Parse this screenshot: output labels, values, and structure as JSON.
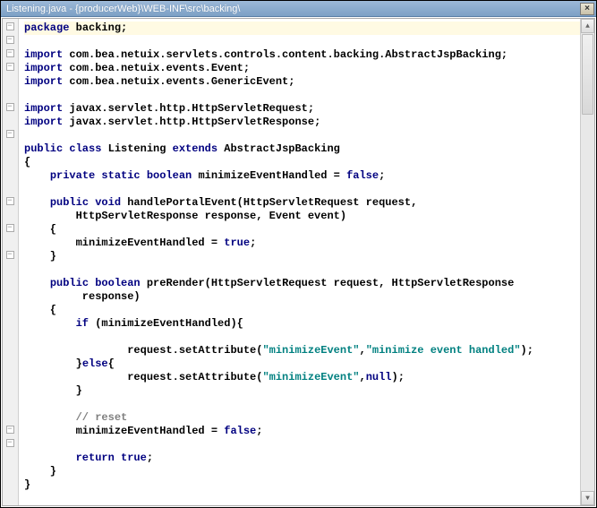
{
  "title": "Listening.java - {producerWeb}\\WEB-INF\\src\\backing\\",
  "close_label": "×",
  "gutter": {
    "fold_marks": [
      58,
      73,
      88,
      103,
      148,
      178,
      253,
      283,
      313,
      508,
      523
    ],
    "override_at": 283,
    "override_glyph": "○"
  },
  "code": {
    "lines": [
      {
        "type": "hl",
        "segments": [
          [
            "kw",
            "package"
          ],
          [
            "plain",
            " backing;"
          ]
        ]
      },
      {
        "segments": []
      },
      {
        "segments": [
          [
            "kw",
            "import"
          ],
          [
            "plain",
            " com.bea.netuix.servlets.controls.content.backing.AbstractJspBacking;"
          ]
        ]
      },
      {
        "segments": [
          [
            "kw",
            "import"
          ],
          [
            "plain",
            " com.bea.netuix.events.Event;"
          ]
        ]
      },
      {
        "segments": [
          [
            "kw",
            "import"
          ],
          [
            "plain",
            " com.bea.netuix.events.GenericEvent;"
          ]
        ]
      },
      {
        "segments": []
      },
      {
        "segments": [
          [
            "kw",
            "import"
          ],
          [
            "plain",
            " javax.servlet.http.HttpServletRequest;"
          ]
        ]
      },
      {
        "segments": [
          [
            "kw",
            "import"
          ],
          [
            "plain",
            " javax.servlet.http.HttpServletResponse;"
          ]
        ]
      },
      {
        "segments": []
      },
      {
        "segments": [
          [
            "kw",
            "public class"
          ],
          [
            "plain",
            " Listening "
          ],
          [
            "kw",
            "extends"
          ],
          [
            "plain",
            " AbstractJspBacking"
          ]
        ]
      },
      {
        "segments": [
          [
            "plain",
            "{"
          ]
        ]
      },
      {
        "segments": [
          [
            "plain",
            "    "
          ],
          [
            "kw",
            "private static boolean"
          ],
          [
            "plain",
            " minimizeEventHandled = "
          ],
          [
            "kw",
            "false"
          ],
          [
            "plain",
            ";"
          ]
        ]
      },
      {
        "segments": []
      },
      {
        "segments": [
          [
            "plain",
            "    "
          ],
          [
            "kw",
            "public void"
          ],
          [
            "plain",
            " handlePortalEvent(HttpServletRequest request,"
          ]
        ]
      },
      {
        "segments": [
          [
            "plain",
            "        HttpServletResponse response, Event event)"
          ]
        ]
      },
      {
        "segments": [
          [
            "plain",
            "    {"
          ]
        ]
      },
      {
        "segments": [
          [
            "plain",
            "        minimizeEventHandled = "
          ],
          [
            "kw",
            "true"
          ],
          [
            "plain",
            ";"
          ]
        ]
      },
      {
        "segments": [
          [
            "plain",
            "    }"
          ]
        ]
      },
      {
        "segments": []
      },
      {
        "segments": [
          [
            "plain",
            "    "
          ],
          [
            "kw",
            "public boolean"
          ],
          [
            "plain",
            " preRender(HttpServletRequest request, HttpServletResponse"
          ]
        ]
      },
      {
        "segments": [
          [
            "plain",
            "         response)"
          ]
        ]
      },
      {
        "segments": [
          [
            "plain",
            "    {"
          ]
        ]
      },
      {
        "segments": [
          [
            "plain",
            "        "
          ],
          [
            "kw",
            "if"
          ],
          [
            "plain",
            " (minimizeEventHandled){"
          ]
        ]
      },
      {
        "segments": []
      },
      {
        "segments": [
          [
            "plain",
            "                request.setAttribute("
          ],
          [
            "str",
            "\"minimizeEvent\""
          ],
          [
            "plain",
            ","
          ],
          [
            "str",
            "\"minimize event handled\""
          ],
          [
            "plain",
            ");"
          ]
        ]
      },
      {
        "segments": [
          [
            "plain",
            "        }"
          ],
          [
            "kw",
            "else"
          ],
          [
            "plain",
            "{"
          ]
        ]
      },
      {
        "segments": [
          [
            "plain",
            "                request.setAttribute("
          ],
          [
            "str",
            "\"minimizeEvent\""
          ],
          [
            "plain",
            ","
          ],
          [
            "kw",
            "null"
          ],
          [
            "plain",
            ");"
          ]
        ]
      },
      {
        "segments": [
          [
            "plain",
            "        }"
          ]
        ]
      },
      {
        "segments": []
      },
      {
        "segments": [
          [
            "plain",
            "        "
          ],
          [
            "com",
            "// reset"
          ]
        ]
      },
      {
        "segments": [
          [
            "plain",
            "        minimizeEventHandled = "
          ],
          [
            "kw",
            "false"
          ],
          [
            "plain",
            ";"
          ]
        ]
      },
      {
        "segments": []
      },
      {
        "segments": [
          [
            "plain",
            "        "
          ],
          [
            "kw",
            "return true"
          ],
          [
            "plain",
            ";"
          ]
        ]
      },
      {
        "segments": [
          [
            "plain",
            "    }"
          ]
        ]
      },
      {
        "segments": [
          [
            "plain",
            "}"
          ]
        ]
      }
    ]
  },
  "scrollbar": {
    "up": "▲",
    "down": "▼"
  }
}
